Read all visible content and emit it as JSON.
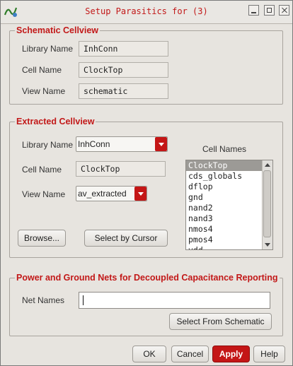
{
  "window": {
    "title": "Setup Parasitics for (3)"
  },
  "schematic": {
    "legend": "Schematic Cellview",
    "library_label": "Library Name",
    "library_value": "InhConn",
    "cell_label": "Cell Name",
    "cell_value": "ClockTop",
    "view_label": "View Name",
    "view_value": "schematic"
  },
  "extracted": {
    "legend": "Extracted Cellview",
    "library_label": "Library Name",
    "library_value": "InhConn",
    "cell_label": "Cell Name",
    "cell_value": "ClockTop",
    "view_label": "View Name",
    "view_value": "av_extracted",
    "cell_names_label": "Cell Names",
    "cell_names": [
      "ClockTop",
      "cds_globals",
      "dflop",
      "gnd",
      "nand2",
      "nand3",
      "nmos4",
      "pmos4",
      "vdd"
    ],
    "selected_cell": "ClockTop",
    "browse_label": "Browse...",
    "select_cursor_label": "Select by Cursor"
  },
  "nets": {
    "legend": "Power and Ground Nets for Decoupled Capacitance Reporting",
    "net_names_label": "Net Names",
    "net_names_value": "",
    "select_schematic_label": "Select From Schematic"
  },
  "footer": {
    "ok": "OK",
    "cancel": "Cancel",
    "apply": "Apply",
    "help": "Help"
  },
  "colors": {
    "accent": "#c41616",
    "legend_text": "#c21818",
    "background": "#e7e4df"
  }
}
